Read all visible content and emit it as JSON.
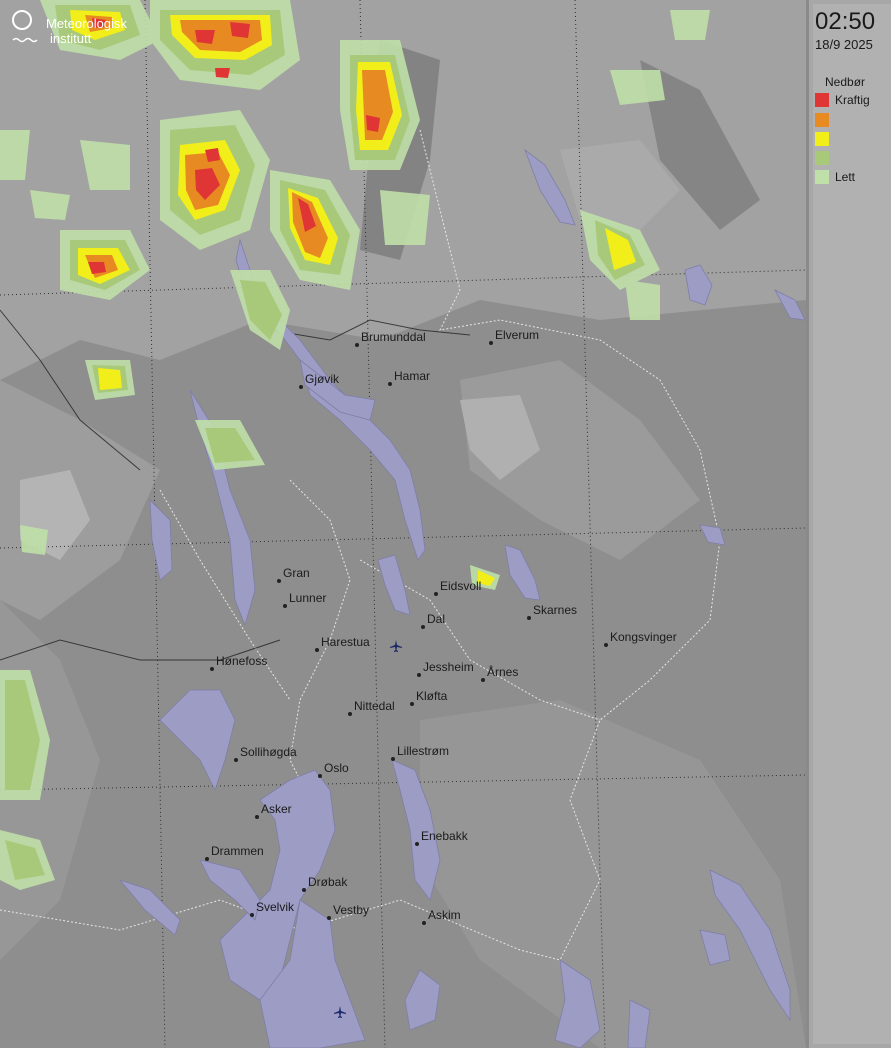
{
  "brand": {
    "line1": "Meteorologisk",
    "line2": "institutt"
  },
  "time": "02:50",
  "date": "18/9 2025",
  "legend": {
    "title": "Nedbør",
    "levels": [
      {
        "label": "Kraftig",
        "color": "#e03535"
      },
      {
        "label": "",
        "color": "#e88a22"
      },
      {
        "label": "",
        "color": "#f2ee1a"
      },
      {
        "label": "",
        "color": "#a9c97a"
      },
      {
        "label": "Lett",
        "color": "#bfe0a8"
      }
    ]
  },
  "cities": [
    {
      "name": "Brumunddal"
    },
    {
      "name": "Elverum"
    },
    {
      "name": "Gjøvik"
    },
    {
      "name": "Hamar"
    },
    {
      "name": "Gran"
    },
    {
      "name": "Lunner"
    },
    {
      "name": "Eidsvoll"
    },
    {
      "name": "Dal"
    },
    {
      "name": "Skarnes"
    },
    {
      "name": "Harestua"
    },
    {
      "name": "Kongsvinger"
    },
    {
      "name": "Hønefoss"
    },
    {
      "name": "Jessheim"
    },
    {
      "name": "Årnes"
    },
    {
      "name": "Kløfta"
    },
    {
      "name": "Nittedal"
    },
    {
      "name": "Lillestrøm"
    },
    {
      "name": "Sollihøgda"
    },
    {
      "name": "Oslo"
    },
    {
      "name": "Asker"
    },
    {
      "name": "Enebakk"
    },
    {
      "name": "Drammen"
    },
    {
      "name": "Drøbak"
    },
    {
      "name": "Svelvik"
    },
    {
      "name": "Vestby"
    },
    {
      "name": "Askim"
    }
  ],
  "icons": [
    "airport-icon",
    "met-logo-icon"
  ]
}
